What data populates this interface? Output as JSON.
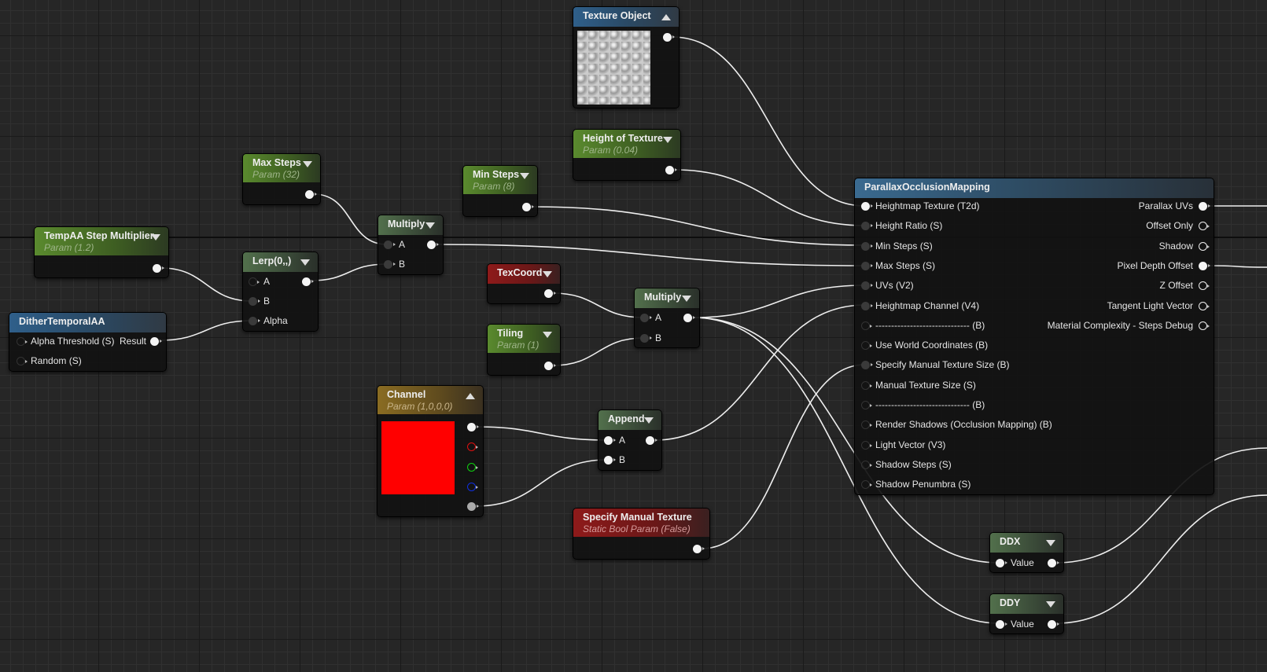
{
  "nodes": {
    "texture_object": {
      "title": "Texture Object"
    },
    "height_of_texture": {
      "title": "Height of Texture",
      "sub": "Param (0.04)"
    },
    "max_steps": {
      "title": "Max Steps",
      "sub": "Param (32)"
    },
    "min_steps": {
      "title": "Min Steps",
      "sub": "Param (8)"
    },
    "tempaa": {
      "title": "TempAA Step Multiplier",
      "sub": "Param (1.2)"
    },
    "dither": {
      "title": "DitherTemporalAA",
      "inputs": [
        "Alpha Threshold (S)",
        "Random (S)"
      ],
      "output": "Result"
    },
    "lerp": {
      "title": "Lerp(0,,)",
      "inputs": [
        "A",
        "B",
        "Alpha"
      ]
    },
    "multiply1": {
      "title": "Multiply",
      "inputs": [
        "A",
        "B"
      ]
    },
    "texcoord": {
      "title": "TexCoord"
    },
    "tiling": {
      "title": "Tiling",
      "sub": "Param (1)"
    },
    "multiply2": {
      "title": "Multiply",
      "inputs": [
        "A",
        "B"
      ]
    },
    "channel": {
      "title": "Channel",
      "sub": "Param (1,0,0,0)",
      "color": "#ff0000"
    },
    "append": {
      "title": "Append",
      "inputs": [
        "A",
        "B"
      ]
    },
    "specify_manual": {
      "title": "Specify Manual Texture",
      "sub": "Static Bool Param (False)"
    },
    "pom": {
      "title": "ParallaxOcclusionMapping",
      "inputs": [
        "Heightmap Texture (T2d)",
        "Height Ratio (S)",
        "Min Steps (S)",
        "Max Steps (S)",
        "UVs (V2)",
        "Heightmap Channel (V4)",
        "------------------------------ (B)",
        "Use World Coordinates (B)",
        "Specify Manual Texture Size (B)",
        "Manual Texture Size (S)",
        "------------------------------ (B)",
        "Render Shadows (Occlusion Mapping) (B)",
        "Light Vector (V3)",
        "Shadow Steps (S)",
        "Shadow Penumbra (S)"
      ],
      "outputs": [
        "Parallax UVs",
        "Offset Only",
        "Shadow",
        "Pixel Depth Offset",
        "Z Offset",
        "Tangent Light Vector",
        "Material Complexity - Steps Debug"
      ]
    },
    "ddx": {
      "title": "DDX",
      "input": "Value"
    },
    "ddy": {
      "title": "DDY",
      "input": "Value"
    }
  }
}
